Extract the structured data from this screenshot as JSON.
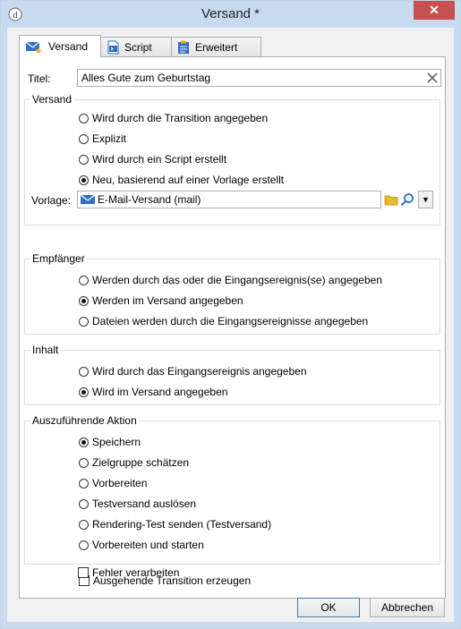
{
  "window": {
    "title": "Versand *",
    "close_symbol": "✕"
  },
  "tabs": [
    {
      "label": "Versand",
      "icon": "mail-icon",
      "active": true
    },
    {
      "label": "Script",
      "icon": "script-icon",
      "active": false
    },
    {
      "label": "Erweitert",
      "icon": "clipboard-icon",
      "active": false
    }
  ],
  "title_field": {
    "label": "Titel:",
    "value": "Alles Gute zum Geburtstag"
  },
  "versand_group": {
    "legend": "Versand",
    "options": [
      {
        "label": "Wird durch die Transition angegeben",
        "selected": false
      },
      {
        "label": "Explizit",
        "selected": false
      },
      {
        "label": "Wird durch ein Script erstellt",
        "selected": false
      },
      {
        "label": "Neu, basierend auf einer Vorlage erstellt",
        "selected": true
      }
    ],
    "template_label": "Vorlage:",
    "template_value": "E-Mail-Versand (mail)"
  },
  "empfaenger_group": {
    "legend": "Empfänger",
    "options": [
      {
        "label": "Werden durch das oder die Eingangsereignis(se) angegeben",
        "selected": false
      },
      {
        "label": "Werden im Versand angegeben",
        "selected": true
      },
      {
        "label": "Dateien werden durch die Eingangsereignisse angegeben",
        "selected": false
      }
    ]
  },
  "inhalt_group": {
    "legend": "Inhalt",
    "options": [
      {
        "label": "Wird durch das Eingangsereignis angegeben",
        "selected": false
      },
      {
        "label": "Wird im Versand angegeben",
        "selected": true
      }
    ]
  },
  "aktion_group": {
    "legend": "Auszuführende Aktion",
    "options": [
      {
        "label": "Speichern",
        "selected": true
      },
      {
        "label": "Zielgruppe schätzen",
        "selected": false
      },
      {
        "label": "Vorbereiten",
        "selected": false
      },
      {
        "label": "Testversand auslösen",
        "selected": false
      },
      {
        "label": "Rendering-Test senden (Testversand)",
        "selected": false
      },
      {
        "label": "Vorbereiten und starten",
        "selected": false
      }
    ]
  },
  "checkboxes": [
    {
      "label": "Ausgehende Transition erzeugen",
      "checked": false
    },
    {
      "label": "Fehler verarbeiten",
      "checked": false
    }
  ],
  "buttons": {
    "ok": "OK",
    "cancel": "Abbrechen"
  },
  "colors": {
    "window_frame": "#c8daf0",
    "close_button": "#c75050",
    "folder_icon": "#e8b830",
    "search_icon": "#2a6fc9"
  }
}
